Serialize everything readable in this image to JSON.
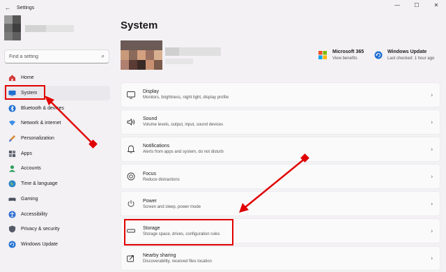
{
  "window": {
    "title": "Settings",
    "back_icon": "back-arrow-icon",
    "minimize": "—",
    "maximize": "☐",
    "close": "✕"
  },
  "search": {
    "placeholder": "Find a setting"
  },
  "sidebar": {
    "items": [
      {
        "label": "Home",
        "icon": "home-icon",
        "color": "#d33a3a"
      },
      {
        "label": "System",
        "icon": "system-icon",
        "color": "#1f6fd1",
        "active": true
      },
      {
        "label": "Bluetooth & devices",
        "icon": "bluetooth-icon",
        "color": "#1f6fd1"
      },
      {
        "label": "Network & internet",
        "icon": "network-icon",
        "color": "#3a8ee6"
      },
      {
        "label": "Personalization",
        "icon": "brush-icon",
        "color": "#d68a3c"
      },
      {
        "label": "Apps",
        "icon": "apps-icon",
        "color": "#555a66"
      },
      {
        "label": "Accounts",
        "icon": "accounts-icon",
        "color": "#2aa05a"
      },
      {
        "label": "Time & language",
        "icon": "globe-icon",
        "color": "#2f86c9"
      },
      {
        "label": "Gaming",
        "icon": "gaming-icon",
        "color": "#4a5160"
      },
      {
        "label": "Accessibility",
        "icon": "accessibility-icon",
        "color": "#2f6fd1"
      },
      {
        "label": "Privacy & security",
        "icon": "shield-icon",
        "color": "#555a66"
      },
      {
        "label": "Windows Update",
        "icon": "update-icon",
        "color": "#1f6fd1"
      }
    ]
  },
  "main": {
    "title": "System",
    "promos": [
      {
        "title": "Microsoft 365",
        "subtitle": "View benefits",
        "icon": "microsoft-365-icon"
      },
      {
        "title": "Windows Update",
        "subtitle": "Last checked: 1 hour ago",
        "icon": "windows-update-icon"
      }
    ],
    "cards": [
      {
        "title": "Display",
        "desc": "Monitors, brightness, night light, display profile",
        "icon": "display-icon"
      },
      {
        "title": "Sound",
        "desc": "Volume levels, output, input, sound devices",
        "icon": "speaker-icon"
      },
      {
        "title": "Notifications",
        "desc": "Alerts from apps and system, do not disturb",
        "icon": "bell-icon"
      },
      {
        "title": "Focus",
        "desc": "Reduce distractions",
        "icon": "focus-icon"
      },
      {
        "title": "Power",
        "desc": "Screen and sleep, power mode",
        "icon": "power-icon"
      },
      {
        "title": "Storage",
        "desc": "Storage space, drives, configuration rules",
        "icon": "storage-icon"
      },
      {
        "title": "Nearby sharing",
        "desc": "Discoverability, received files location",
        "icon": "share-icon"
      }
    ]
  },
  "colors": {
    "annotation": "#e00000",
    "accent": "#1f6fd1"
  }
}
